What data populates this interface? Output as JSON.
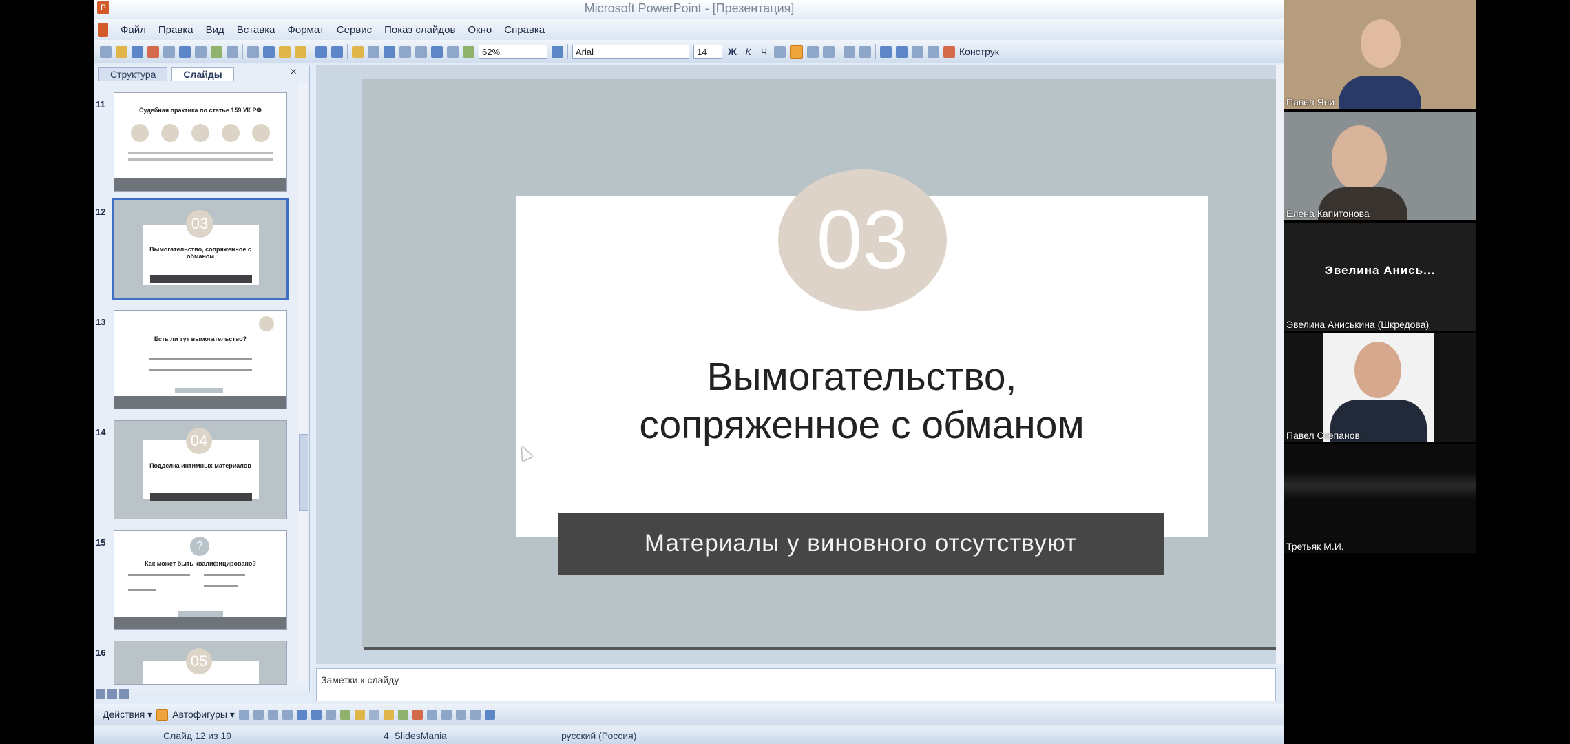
{
  "window": {
    "title": "Microsoft PowerPoint - [Презентация]"
  },
  "menu": [
    "Файл",
    "Правка",
    "Вид",
    "Вставка",
    "Формат",
    "Сервис",
    "Показ слайдов",
    "Окно",
    "Справка"
  ],
  "toolbar": {
    "zoom": "62%",
    "font": "Arial",
    "size": "14",
    "designer": "Конструк"
  },
  "panel": {
    "tabs": [
      "Структура",
      "Слайды"
    ],
    "close": "×",
    "slides": [
      {
        "num": "11",
        "title": "Судебная практика по статье 159 УК РФ"
      },
      {
        "num": "12",
        "circle": "03",
        "title": "Вымогательство, сопряженное с обманом"
      },
      {
        "num": "13",
        "title": "Есть ли тут вымогательство?"
      },
      {
        "num": "14",
        "circle": "04",
        "title": "Подделка интимных материалов"
      },
      {
        "num": "15",
        "circle": "?",
        "title": "Как может быть квалифицировано?"
      },
      {
        "num": "16",
        "circle": "05"
      }
    ]
  },
  "slide": {
    "number_circle": "03",
    "title_line1": "Вымогательство,",
    "title_line2": "сопряженное с обманом",
    "subtitle": "Материалы у виновного отсутствуют"
  },
  "notes": {
    "placeholder": "Заметки к слайду"
  },
  "drawbar": {
    "actions": "Действия ▾",
    "autoshapes": "Автофигуры ▾"
  },
  "status": {
    "slide": "Слайд 12 из 19",
    "theme": "4_SlidesMania",
    "lang": "русский (Россия)"
  },
  "participants": [
    {
      "name": "Павел Яни"
    },
    {
      "name": "Елена Капитонова"
    },
    {
      "name": "Эвелина Аниськи... ",
      "display": "Эвелина Анись...",
      "full": "Эвелина Аниськина (Шкредова)"
    },
    {
      "name": "Павел Степанов"
    },
    {
      "name": "Третьяк М.И."
    }
  ],
  "colors": {
    "accent": "#3d6fc4",
    "slide_bg": "#b8c3c8",
    "circle": "#ddd3c8",
    "subbar": "#464646"
  }
}
